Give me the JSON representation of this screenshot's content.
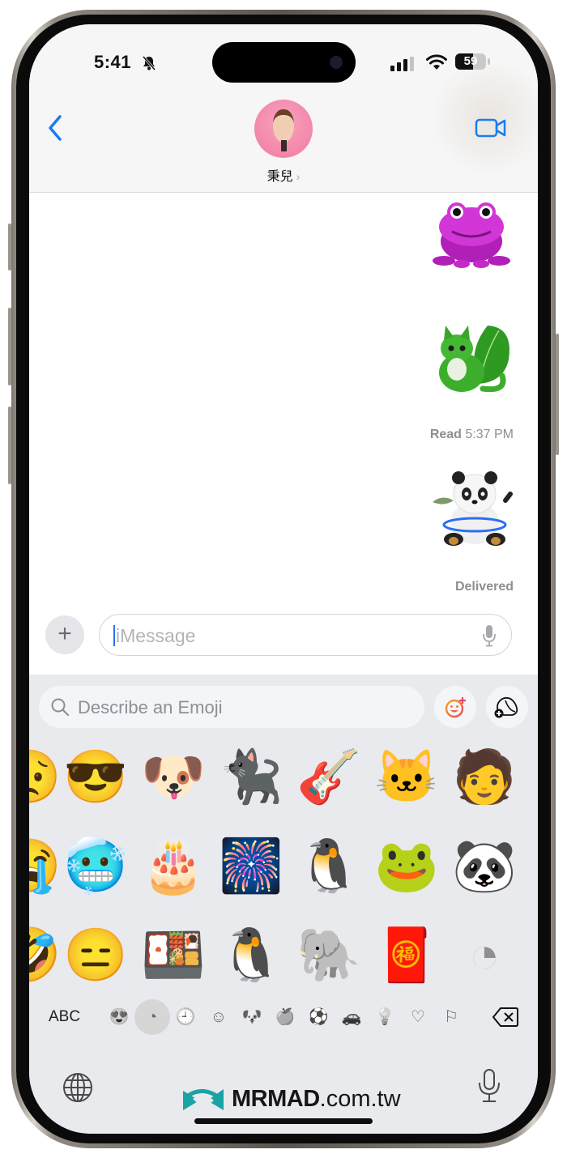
{
  "status_bar": {
    "time": "5:41",
    "silent_icon": "bell-slash-icon",
    "signal_icon": "cellular-signal-icon",
    "wifi_icon": "wifi-icon",
    "battery_level": "59",
    "battery_fraction": 0.59
  },
  "header": {
    "back_icon": "chevron-left-icon",
    "contact_name": "秉兒",
    "contact_chevron": "›",
    "avatar_icon": "memoji-avatar",
    "video_icon": "video-camera-icon"
  },
  "conversation": {
    "messages": [
      {
        "type": "sticker",
        "description": "magenta frog genmoji",
        "emoji": "🐸"
      },
      {
        "type": "sticker",
        "description": "green leaf cat genmoji",
        "emoji": "🐱"
      },
      {
        "type": "receipt",
        "label": "Read",
        "time": "5:37 PM"
      },
      {
        "type": "sticker",
        "description": "panda with fish and hula hoop genmoji",
        "emoji": "🐼"
      },
      {
        "type": "receipt",
        "label": "Delivered"
      }
    ]
  },
  "composer": {
    "plus_label": "+",
    "placeholder": "iMessage",
    "mic_icon": "microphone-icon"
  },
  "keyboard": {
    "search_placeholder": "Describe an Emoji",
    "genmoji_button_icon": "genmoji-create-icon",
    "sticker_button_icon": "add-sticker-icon",
    "grid": [
      [
        "😥",
        "😎",
        "🐶",
        "🐈‍⬛",
        "🎸",
        "🐱",
        "🧑"
      ],
      [
        "😭",
        "🥶",
        "🎂",
        "🎆",
        "🐧",
        "🐸",
        "🐼"
      ],
      [
        "🤣",
        "😑",
        "🍱",
        "🐧",
        "🐘",
        "🧧",
        "◔"
      ]
    ],
    "grid_descriptions": [
      [
        "crying face (partial)",
        "sunglasses face",
        "french bulldog",
        "black cat eating noodles",
        "cat playing guitar on stage",
        "green leaf cat",
        "person holding bento"
      ],
      [
        "crying face (partial)",
        "freezing face with snow cloud",
        "birthday cake",
        "fireworks rocket",
        "penguin drummer",
        "magenta frog",
        "panda with hula hoop"
      ],
      [
        "laughing face (partial)",
        "face with tengu mask",
        "hands holding bento",
        "penguin with drumsticks",
        "elephant on island with umbrella",
        "red envelope with coins",
        "sticker outline"
      ]
    ],
    "abc_label": "ABC",
    "categories": [
      {
        "name": "recent-memoji",
        "glyph": "😍",
        "selected": false
      },
      {
        "name": "stickers",
        "glyph": "◔",
        "selected": true
      },
      {
        "name": "frequently-used",
        "glyph": "🕘",
        "selected": false
      },
      {
        "name": "smileys",
        "glyph": "☺",
        "selected": false
      },
      {
        "name": "animals",
        "glyph": "🐶",
        "selected": false
      },
      {
        "name": "food",
        "glyph": "🍏",
        "selected": false
      },
      {
        "name": "activity",
        "glyph": "⚽",
        "selected": false
      },
      {
        "name": "travel",
        "glyph": "🚗",
        "selected": false
      },
      {
        "name": "objects",
        "glyph": "💡",
        "selected": false
      },
      {
        "name": "symbols",
        "glyph": "♡",
        "selected": false
      },
      {
        "name": "flags",
        "glyph": "⚐",
        "selected": false
      }
    ],
    "delete_icon": "delete-backward-icon",
    "globe_icon": "globe-icon",
    "dictation_icon": "microphone-icon"
  },
  "watermark": {
    "brand": "MRMAD",
    "domain": ".com.tw",
    "color": "#1aa3a3"
  },
  "colors": {
    "accent": "#1a7cf2",
    "avatar_bg": "#f585a8",
    "secondary_text": "#8e8e93",
    "keyboard_bg": "#e9eaee"
  }
}
